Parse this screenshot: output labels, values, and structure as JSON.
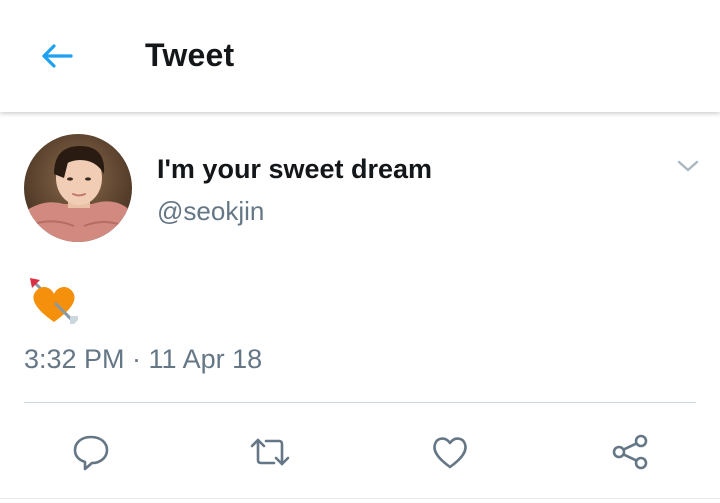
{
  "header": {
    "title": "Tweet",
    "back_icon": "arrow-left-icon"
  },
  "tweet": {
    "display_name": "I'm your sweet dream",
    "handle": "@seokjin",
    "text_emoji": "heart-with-arrow",
    "timestamp": "3:32 PM · 11 Apr 18",
    "more_icon": "chevron-down-icon"
  },
  "actions": {
    "reply_icon": "reply-icon",
    "retweet_icon": "retweet-icon",
    "like_icon": "heart-icon",
    "share_icon": "share-icon"
  },
  "colors": {
    "accent": "#1da1f2",
    "text_primary": "#14171a",
    "text_secondary": "#657786",
    "icon_gray": "#657786",
    "divider": "#ccd6dd",
    "emoji_heart": "#f4900c"
  }
}
